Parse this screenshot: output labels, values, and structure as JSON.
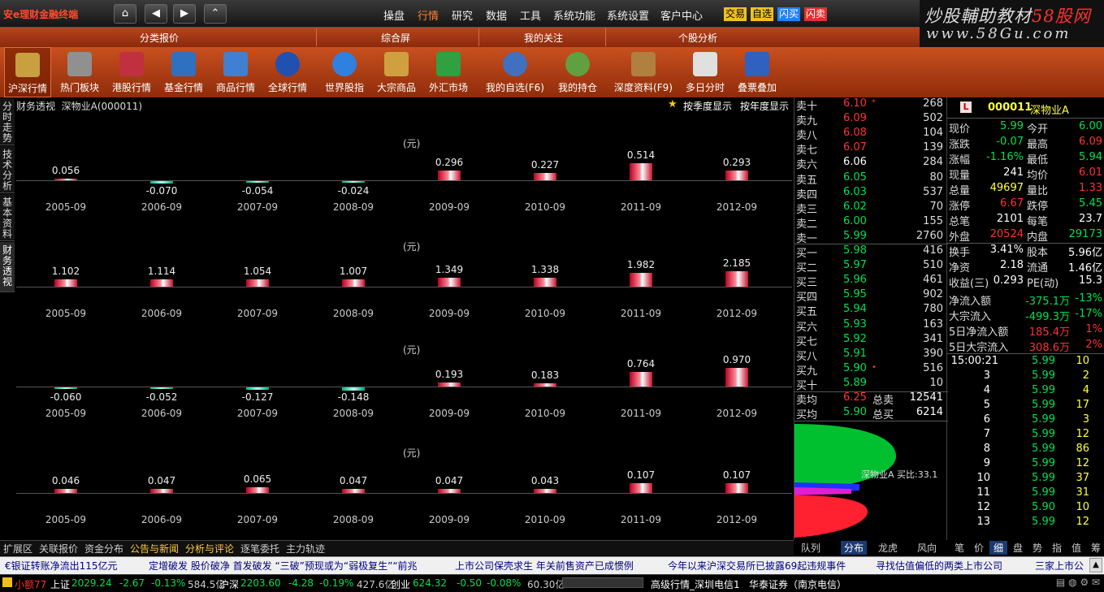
{
  "app": {
    "logo": "安e理财金融终端"
  },
  "nav": {
    "home": "⌂",
    "back": "◀",
    "forward": "▶",
    "up": "⌃"
  },
  "menu": [
    "操盘",
    "行情",
    "研究",
    "数据",
    "工具",
    "系统功能",
    "系统设置",
    "客户中心"
  ],
  "tags": [
    {
      "label": "交易",
      "color": "#f0c020"
    },
    {
      "label": "自选",
      "color": "#f0c020"
    },
    {
      "label": "闪买",
      "color": "#2080ff"
    },
    {
      "label": "闪卖",
      "color": "#e03030"
    }
  ],
  "brand": {
    "line1a": "炒股輔助教材",
    "line1b": "58股网",
    "line2": "www.58Gu.com"
  },
  "categories": [
    "分类报价",
    "综合屏",
    "我的关注",
    "个股分析"
  ],
  "tools": [
    {
      "label": "沪深行情",
      "color": "#c8a040"
    },
    {
      "label": "热门板块",
      "color": "#909090"
    },
    {
      "label": "港股行情",
      "color": "#c03040"
    },
    {
      "label": "基金行情",
      "color": "#3070c0"
    },
    {
      "label": "商品行情",
      "color": "#4080d0"
    },
    {
      "label": "全球行情",
      "color": "#2050b0"
    },
    {
      "label": "世界股指",
      "color": "#3080e0"
    },
    {
      "label": "大宗商品",
      "color": "#d0a040"
    },
    {
      "label": "外汇市场",
      "color": "#30a040"
    },
    {
      "label": "我的自选(F6)",
      "color": "#4070c0"
    },
    {
      "label": "我的持仓",
      "color": "#60a040"
    },
    {
      "label": "深度资料(F9)",
      "color": "#b08040"
    },
    {
      "label": "多日分时",
      "color": "#e0e0e0"
    },
    {
      "label": "叠票叠加",
      "color": "#3060c0"
    }
  ],
  "vtabs": [
    "分时走势",
    "技术分析",
    "基本资料",
    "财务透视"
  ],
  "main": {
    "title": "财务透视",
    "stock": "深物业A(000011)",
    "opt1": "按季度显示",
    "opt2": "按年度显示",
    "unit": "(元)"
  },
  "chart_data": [
    {
      "type": "bar",
      "ylabel": "(元)",
      "categories": [
        "2005-09",
        "2006-09",
        "2007-09",
        "2008-09",
        "2009-09",
        "2010-09",
        "2011-09",
        "2012-09"
      ],
      "values": [
        0.056,
        -0.07,
        -0.054,
        -0.024,
        0.296,
        0.227,
        0.514,
        0.293
      ]
    },
    {
      "type": "bar",
      "ylabel": "(元)",
      "categories": [
        "2005-09",
        "2006-09",
        "2007-09",
        "2008-09",
        "2009-09",
        "2010-09",
        "2011-09",
        "2012-09"
      ],
      "values": [
        1.102,
        1.114,
        1.054,
        1.007,
        1.349,
        1.338,
        1.982,
        2.185
      ]
    },
    {
      "type": "bar",
      "ylabel": "(元)",
      "categories": [
        "2005-09",
        "2006-09",
        "2007-09",
        "2008-09",
        "2009-09",
        "2010-09",
        "2011-09",
        "2012-09"
      ],
      "values": [
        -0.06,
        -0.052,
        -0.127,
        -0.148,
        0.193,
        0.183,
        0.764,
        0.97
      ]
    },
    {
      "type": "bar",
      "ylabel": "(元)",
      "categories": [
        "2005-09",
        "2006-09",
        "2007-09",
        "2008-09",
        "2009-09",
        "2010-09",
        "2011-09",
        "2012-09"
      ],
      "values": [
        0.046,
        0.047,
        0.065,
        0.047,
        0.047,
        0.043,
        0.107,
        0.107
      ]
    }
  ],
  "labels": [
    "0.056",
    "-0.070",
    "-0.054",
    "-0.024",
    "0.296",
    "0.227",
    "0.514",
    "0.293",
    "1.102",
    "1.114",
    "1.054",
    "1.007",
    "1.349",
    "1.338",
    "1.982",
    "2.185",
    "-0.060",
    "-0.052",
    "-0.127",
    "-0.148",
    "0.193",
    "0.183",
    "0.764",
    "0.970",
    "0.046",
    "0.047",
    "0.065",
    "0.047",
    "0.047",
    "0.043",
    "0.107",
    "0.107"
  ],
  "book": {
    "sells": [
      {
        "name": "卖十",
        "price": "6.10",
        "vol": "268",
        "mark": "*",
        "pc": "red"
      },
      {
        "name": "卖九",
        "price": "6.09",
        "vol": "502",
        "pc": "red"
      },
      {
        "name": "卖八",
        "price": "6.08",
        "vol": "104",
        "pc": "red"
      },
      {
        "name": "卖七",
        "price": "6.07",
        "vol": "139",
        "pc": "red"
      },
      {
        "name": "卖六",
        "price": "6.06",
        "vol": "284",
        "pc": "wht"
      },
      {
        "name": "卖五",
        "price": "6.05",
        "vol": "80",
        "pc": "grn"
      },
      {
        "name": "卖四",
        "price": "6.03",
        "vol": "537",
        "pc": "grn"
      },
      {
        "name": "卖三",
        "price": "6.02",
        "vol": "70",
        "pc": "grn"
      },
      {
        "name": "卖二",
        "price": "6.00",
        "vol": "155",
        "pc": "grn"
      },
      {
        "name": "卖一",
        "price": "5.99",
        "vol": "2760",
        "pc": "grn"
      }
    ],
    "buys": [
      {
        "name": "买一",
        "price": "5.98",
        "vol": "416",
        "pc": "grn"
      },
      {
        "name": "买二",
        "price": "5.97",
        "vol": "510",
        "pc": "grn"
      },
      {
        "name": "买三",
        "price": "5.96",
        "vol": "461",
        "pc": "grn"
      },
      {
        "name": "买四",
        "price": "5.95",
        "vol": "902",
        "pc": "grn"
      },
      {
        "name": "买五",
        "price": "5.94",
        "vol": "780",
        "pc": "grn"
      },
      {
        "name": "买六",
        "price": "5.93",
        "vol": "163",
        "pc": "grn"
      },
      {
        "name": "买七",
        "price": "5.92",
        "vol": "341",
        "pc": "grn"
      },
      {
        "name": "买八",
        "price": "5.91",
        "vol": "390",
        "pc": "grn"
      },
      {
        "name": "买九",
        "price": "5.90",
        "vol": "516",
        "mark": "•",
        "pc": "grn"
      },
      {
        "name": "买十",
        "price": "5.89",
        "vol": "10",
        "pc": "grn"
      }
    ],
    "avg_sell": {
      "name": "卖均",
      "price": "6.25",
      "k": "总卖",
      "v": "12541"
    },
    "avg_buy": {
      "name": "买均",
      "price": "5.90",
      "k": "总买",
      "v": "6214"
    },
    "chip_label": "深物业A 买比:33.1",
    "tabs": [
      "队列",
      "分布",
      "龙虎",
      "风向"
    ]
  },
  "quote": {
    "badge": "L",
    "code": "000011",
    "name": "深物业A",
    "rows": [
      [
        {
          "k": "现价",
          "v": "5.99",
          "c": "grn"
        },
        {
          "k": "今开",
          "v": "6.00",
          "c": "grn"
        }
      ],
      [
        {
          "k": "涨跌",
          "v": "-0.07",
          "c": "grn"
        },
        {
          "k": "最高",
          "v": "6.09",
          "c": "red"
        }
      ],
      [
        {
          "k": "涨幅",
          "v": "-1.16%",
          "c": "grn"
        },
        {
          "k": "最低",
          "v": "5.94",
          "c": "grn"
        }
      ],
      [
        {
          "k": "现量",
          "v": "241",
          "c": "wht"
        },
        {
          "k": "均价",
          "v": "6.01",
          "c": "red"
        }
      ],
      [
        {
          "k": "总量",
          "v": "49697",
          "c": "yel"
        },
        {
          "k": "量比",
          "v": "1.33",
          "c": "red"
        }
      ],
      [
        {
          "k": "涨停",
          "v": "6.67",
          "c": "red"
        },
        {
          "k": "跌停",
          "v": "5.45",
          "c": "grn"
        }
      ],
      [
        {
          "k": "总笔",
          "v": "2101",
          "c": "wht"
        },
        {
          "k": "每笔",
          "v": "23.7",
          "c": "wht"
        }
      ],
      [
        {
          "k": "外盘",
          "v": "20524",
          "c": "red"
        },
        {
          "k": "内盘",
          "v": "29173",
          "c": "grn"
        }
      ],
      [
        {
          "k": "换手",
          "v": "3.41%",
          "c": "wht"
        },
        {
          "k": "股本",
          "v": "5.96亿",
          "c": "wht"
        }
      ],
      [
        {
          "k": "净资",
          "v": "2.18",
          "c": "wht"
        },
        {
          "k": "流通",
          "v": "1.46亿",
          "c": "wht"
        }
      ],
      [
        {
          "k": "收益(三)",
          "v": "0.293",
          "c": "wht"
        },
        {
          "k": "PE(动)",
          "v": "15.3",
          "c": "wht"
        }
      ]
    ],
    "flows": [
      {
        "k": "净流入额",
        "v": "-375.1万",
        "p": "-13%",
        "c": "grn"
      },
      {
        "k": "大宗流入",
        "v": "-499.3万",
        "p": "-17%",
        "c": "grn"
      },
      {
        "k": "5日净流入额",
        "v": "185.4万",
        "p": "1%",
        "c": "red"
      },
      {
        "k": "5日大宗流入",
        "v": "308.6万",
        "p": "2%",
        "c": "red"
      }
    ],
    "ticks": [
      {
        "t": "15:00:21",
        "p": "5.99",
        "v": "10"
      },
      {
        "t": "3",
        "p": "5.99",
        "v": "2"
      },
      {
        "t": "4",
        "p": "5.99",
        "v": "4"
      },
      {
        "t": "5",
        "p": "5.99",
        "v": "17"
      },
      {
        "t": "6",
        "p": "5.99",
        "v": "3"
      },
      {
        "t": "7",
        "p": "5.99",
        "v": "12"
      },
      {
        "t": "8",
        "p": "5.99",
        "v": "86"
      },
      {
        "t": "9",
        "p": "5.99",
        "v": "12"
      },
      {
        "t": "10",
        "p": "5.99",
        "v": "37"
      },
      {
        "t": "11",
        "p": "5.99",
        "v": "31"
      },
      {
        "t": "12",
        "p": "5.90",
        "v": "10"
      },
      {
        "t": "13",
        "p": "5.99",
        "v": "12"
      }
    ],
    "mini_tabs": [
      "笔",
      "价",
      "细",
      "盘",
      "势",
      "指",
      "值",
      "筹"
    ]
  },
  "bottom_tabs": [
    "扩展区",
    "关联报价",
    "资金分布",
    "公告与新闻",
    "分析与评论",
    "逐笔委托",
    "主力轨迹"
  ],
  "ticker": [
    "€银证转账净流出115亿元",
    "定增破发  股价破净  首发破发 “三破”预现或为“弱极复生”“前兆",
    "上市公司保壳求生  年关前售资产已成惯例",
    "今年以来沪深交易所已披露69起违规事件",
    "寻找估值偏低的两类上市公司",
    "三家上市公"
  ],
  "status": {
    "fund": "小额77",
    "sh": {
      "name": "上证",
      "idx": "2029.24",
      "chg": "-2.67",
      "pct": "-0.13%",
      "amt": "584.5亿"
    },
    "sz": {
      "name": "沪深",
      "idx": "2203.60",
      "chg": "-4.28",
      "pct": "-0.19%",
      "amt": "427.6亿"
    },
    "cy": {
      "name": "创业",
      "idx": "624.32",
      "chg": "-0.50",
      "pct": "-0.08%",
      "amt": "60.30亿"
    },
    "info": "高级行情_深圳电信1",
    "broker": "华泰证券（南京电信）"
  }
}
